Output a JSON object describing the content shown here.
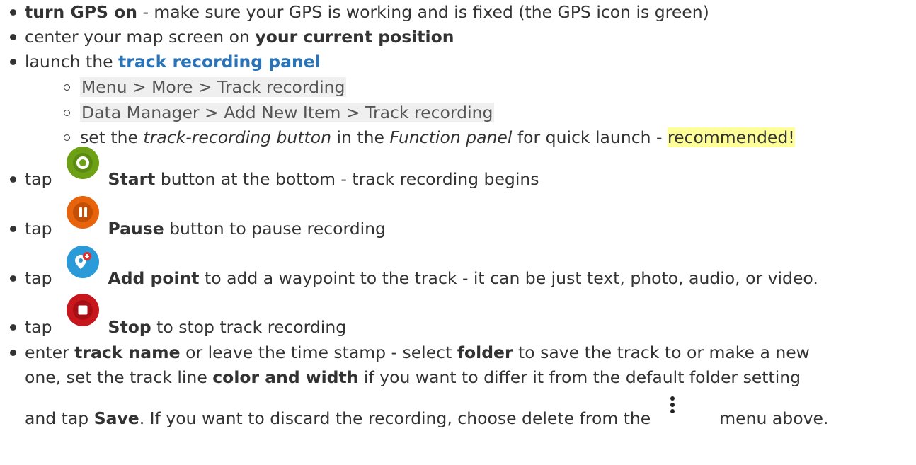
{
  "items": {
    "gps": {
      "bold": "turn GPS on",
      "rest": " - make sure your GPS is working and is fixed (the GPS icon is green)"
    },
    "center": {
      "pre": "center your map screen on ",
      "bold": "your current position"
    },
    "launch": {
      "pre": "launch the ",
      "link": "track recording panel"
    },
    "sub": {
      "menu_path": "Menu > More > Track recording",
      "data_manager_path": "Data Manager > Add New Item > Track recording",
      "set_pre": "set the ",
      "set_italic1": "track-recording button",
      "set_mid": " in the ",
      "set_italic2": "Function panel",
      "set_post": " for quick launch - ",
      "set_highlight": "recommended!"
    },
    "start": {
      "tap": "tap",
      "bold": "Start",
      "rest": " button at the bottom - track recording begins"
    },
    "pause": {
      "tap": "tap",
      "bold": "Pause",
      "rest": " button to pause recording"
    },
    "addpoint": {
      "tap": "tap",
      "bold": "Add point",
      "rest": " to add a waypoint to the track - it can be just text, photo, audio, or video."
    },
    "stop": {
      "tap": "tap",
      "bold": "Stop",
      "rest": " to stop track recording"
    },
    "enter": {
      "pre": "enter ",
      "bold1": "track name",
      "mid1": " or leave the time stamp - select ",
      "bold2": "folder",
      "mid2": " to save the track to or make a new",
      "line2_pre": "one, set the track line ",
      "bold3": "color and width",
      "line2_post": " if you want to differ it from the default folder setting",
      "line3_pre": "and tap ",
      "bold4": "Save",
      "line3_mid": ". If you want to discard the recording, choose delete from the",
      "line3_post": "menu above."
    }
  },
  "icons": {
    "start": {
      "name": "start-record-icon",
      "color": "#6ea015"
    },
    "pause": {
      "name": "pause-record-icon",
      "color": "#e8640c"
    },
    "addpoint": {
      "name": "add-point-icon",
      "color": "#2a9ad8"
    },
    "stop": {
      "name": "stop-record-icon",
      "color": "#c8161d"
    },
    "menu": {
      "name": "more-vertical-icon"
    }
  },
  "colors": {
    "text": "#333333",
    "link": "#2b73b7",
    "code_bg": "#efefef",
    "highlight": "#ffff99"
  }
}
